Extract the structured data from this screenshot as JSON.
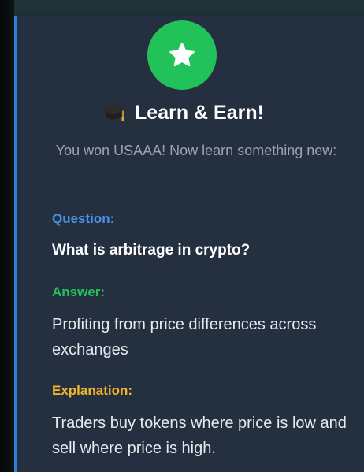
{
  "header": {
    "title": "Learn & Earn!",
    "subtitle": "You won USAAA! Now learn something new:",
    "badge_icon": "star-icon",
    "title_icon": "graduation-cap-icon"
  },
  "question": {
    "label": "Question:",
    "text": "What is arbitrage in crypto?"
  },
  "answer": {
    "label": "Answer:",
    "text": "Profiting from price differences across exchanges"
  },
  "explanation": {
    "label": "Explanation:",
    "text": "Traders buy tokens where price is low and sell where price is high."
  },
  "colors": {
    "badge": "#22c25a",
    "question_label": "#4a90e8",
    "answer_label": "#23c15b",
    "explanation_label": "#f0b52a",
    "card_background": "#243040",
    "accent_border": "#2f7fd8"
  }
}
